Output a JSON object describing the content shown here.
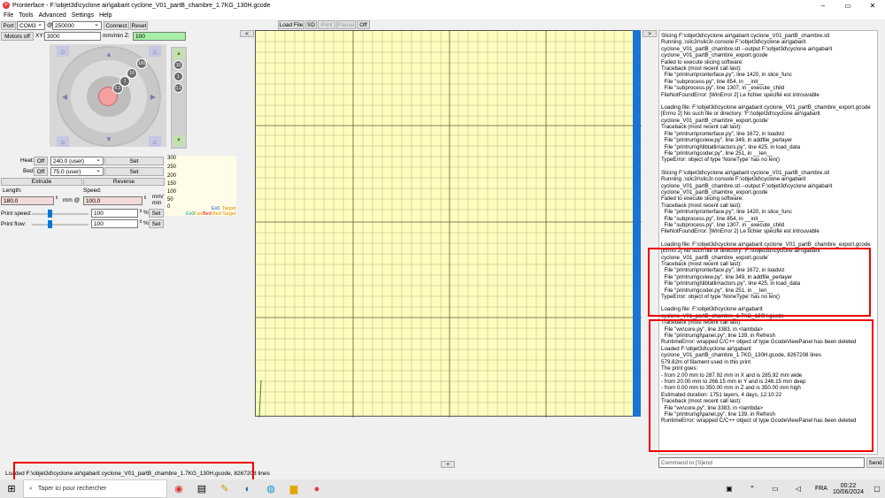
{
  "window": {
    "title": "Pronterface - F:\\objet3d\\cyclone air\\gabarit cyclone_V01_partB_chambre_1.7KG_130H.gcode",
    "app_icon_text": "P"
  },
  "menu": [
    "File",
    "Tools",
    "Advanced",
    "Settings",
    "Help"
  ],
  "connection": {
    "port_label": "Port",
    "port_value": "COM3",
    "at_label": "@",
    "baud_value": "250000",
    "connect_label": "Connect",
    "reset_label": "Reset",
    "motors_off_label": "Motors off",
    "xy_label": "XY:",
    "xy_value": "3000",
    "z_label": "mm/min Z:",
    "z_value": "100"
  },
  "jog": {
    "distances": [
      "100",
      "10",
      "1",
      "0.1"
    ],
    "z_distances": [
      "10",
      "1",
      "0.1"
    ]
  },
  "temps": {
    "heat_label": "Heat:",
    "heat_off": "Off",
    "heat_value": "240.0 (user)",
    "heat_set": "Set",
    "bed_label": "Bed:",
    "bed_off": "Off",
    "bed_value": "75.0 (user)",
    "bed_set": "Set"
  },
  "graph": {
    "y_ticks": [
      "300",
      "250",
      "200",
      "150",
      "100",
      "50",
      "0"
    ],
    "legend_ex0": "Ex0",
    "legend_target": "Target",
    "legend_fan": "Fan",
    "legend_bed": "Bed",
    "legend_bed_target": "Bed Target",
    "colors": {
      "ex0": "#1f5fd6",
      "target": "#e48a00",
      "fan": "#00a0a0",
      "bed": "#d20000"
    }
  },
  "extrude": {
    "extrude_label": "Extrude",
    "reverse_label": "Reverse",
    "length_label": "Length:",
    "length_value": "180,0",
    "length_unit": "mm @",
    "speed_label": "Speed:",
    "speed_value": "100,0",
    "speed_unit_top": "mm/",
    "speed_unit_bottom": "min",
    "print_speed_label": "Print speed:",
    "print_speed_value": "100",
    "print_speed_set": "Set",
    "print_flow_label": "Print flow:",
    "print_flow_value": "100",
    "print_flow_set": "Set",
    "percent": "%"
  },
  "toolbar": {
    "collapse_left": "<",
    "load_file": "Load File",
    "sd": "SD",
    "print": "Print",
    "pause": "Pause",
    "off": "Off",
    "collapse_right": ">",
    "expand_bottom": "+"
  },
  "log": {
    "entries": [
      "Slicing F:\\objet3d\\cyclone air\\gabarit cyclone_V01_partB_chambre.stl\nRunning .\\slic3r\\slic3r-console F:\\objet3d\\cyclone air\\gabarit cyclone_V01_partB_chambre.stl --output F:\\objet3d\\cyclone air\\gabarit cyclone_V01_partB_chambre_export.gcode\nFailed to execute slicing software:\nTraceback (most recent call last):\n  File \"printrun\\pronterface.py\", line 1420, in slice_func\n  File \"subprocess.py\", line 854, in __init__\n  File \"subprocess.py\", line 1307, in _execute_child\nFileNotFoundError: [WinError 2] Le fichier spécifié est introuvable",
      "Loading file: F:\\objet3d\\cyclone air\\gabarit cyclone_V01_partB_chambre_export.gcode\n[Errno 2] No such file or directory: 'F:\\\\objet3d\\\\cyclone air\\\\gabarit cyclone_V01_partB_chambre_export.gcode'\nTraceback (most recent call last):\n  File \"printrun\\pronterface.py\", line 1672, in loadviz\n  File \"printrun\\gcview.py\", line 349, in addfile_perlayer\n  File \"printrun\\gl\\libtatlin\\actors.py\", line 425, in load_data\n  File \"printrun\\gcoder.py\", line 251, in __len__\nTypeError: object of type 'NoneType' has no len()",
      "Slicing F:\\objet3d\\cyclone air\\gabarit cyclone_V01_partB_chambre.stl\nRunning .\\slic3r\\slic3r-console F:\\objet3d\\cyclone air\\gabarit cyclone_V01_partB_chambre.stl --output F:\\objet3d\\cyclone air\\gabarit cyclone_V01_partB_chambre_export.gcode\nFailed to execute slicing software:\nTraceback (most recent call last):\n  File \"printrun\\pronterface.py\", line 1420, in slice_func\n  File \"subprocess.py\", line 854, in __init__\n  File \"subprocess.py\", line 1307, in _execute_child\nFileNotFoundError: [WinError 2] Le fichier spécifié est introuvable",
      "Loading file: F:\\objet3d\\cyclone air\\gabarit cyclone_V01_partB_chambre_export.gcode\n[Errno 2] No such file or directory: 'F:\\\\objet3d\\\\cyclone air\\\\gabarit cyclone_V01_partB_chambre_export.gcode'\nTraceback (most recent call last):\n  File \"printrun\\pronterface.py\", line 1672, in loadviz\n  File \"printrun\\gcview.py\", line 349, in addfile_perlayer\n  File \"printrun\\gl\\libtatlin\\actors.py\", line 425, in load_data\n  File \"printrun\\gcoder.py\", line 251, in __len__\nTypeError: object of type 'NoneType' has no len()",
      "Loading file: F:\\objet3d\\cyclone air\\gabarit cyclone_V01_partB_chambre_1.7KG_130H.gcode\nTraceback (most recent call last):\n  File \"wx\\core.py\", line 3383, in <lambda>\n  File \"printrun\\gl\\panel.py\", line 139, in Refresh\nRuntimeError: wrapped C/C++ object of type GcodeViewPanel has been deleted\nLoaded F:\\objet3d\\cyclone air\\gabarit cyclone_V01_partB_chambre_1.7KG_130H.gcode, 8267208 lines\n579.82m of filament used in this print\nThe print goes:\n- from 2.00 mm to 287.92 mm in X and is 285.92 mm wide\n- from 20.00 mm to 266.15 mm in Y and is 246.15 mm deep\n- from 0.00 mm to 350.00 mm in Z and is 350.00 mm high\nEstimated duration: 1751 layers, 4 days, 12:10:22\nTraceback (most recent call last):\n  File \"wx\\core.py\", line 3383, in <lambda>\n  File \"printrun\\gl\\panel.py\", line 139, in Refresh\nRuntimeError: wrapped C/C++ object of type GcodeViewPanel has been deleted"
    ],
    "command_placeholder": "Command to [S]end",
    "send_label": "Send"
  },
  "status": "Loaded F:\\objet3d\\cyclone air\\gabarit cyclone_V01_partB_chambre_1.7KG_130H.gcode, 8267208 lines",
  "taskbar": {
    "search_placeholder": "Taper ici pour rechercher",
    "lang": "FRA",
    "time": "00:22",
    "date": "10/06/2024"
  }
}
